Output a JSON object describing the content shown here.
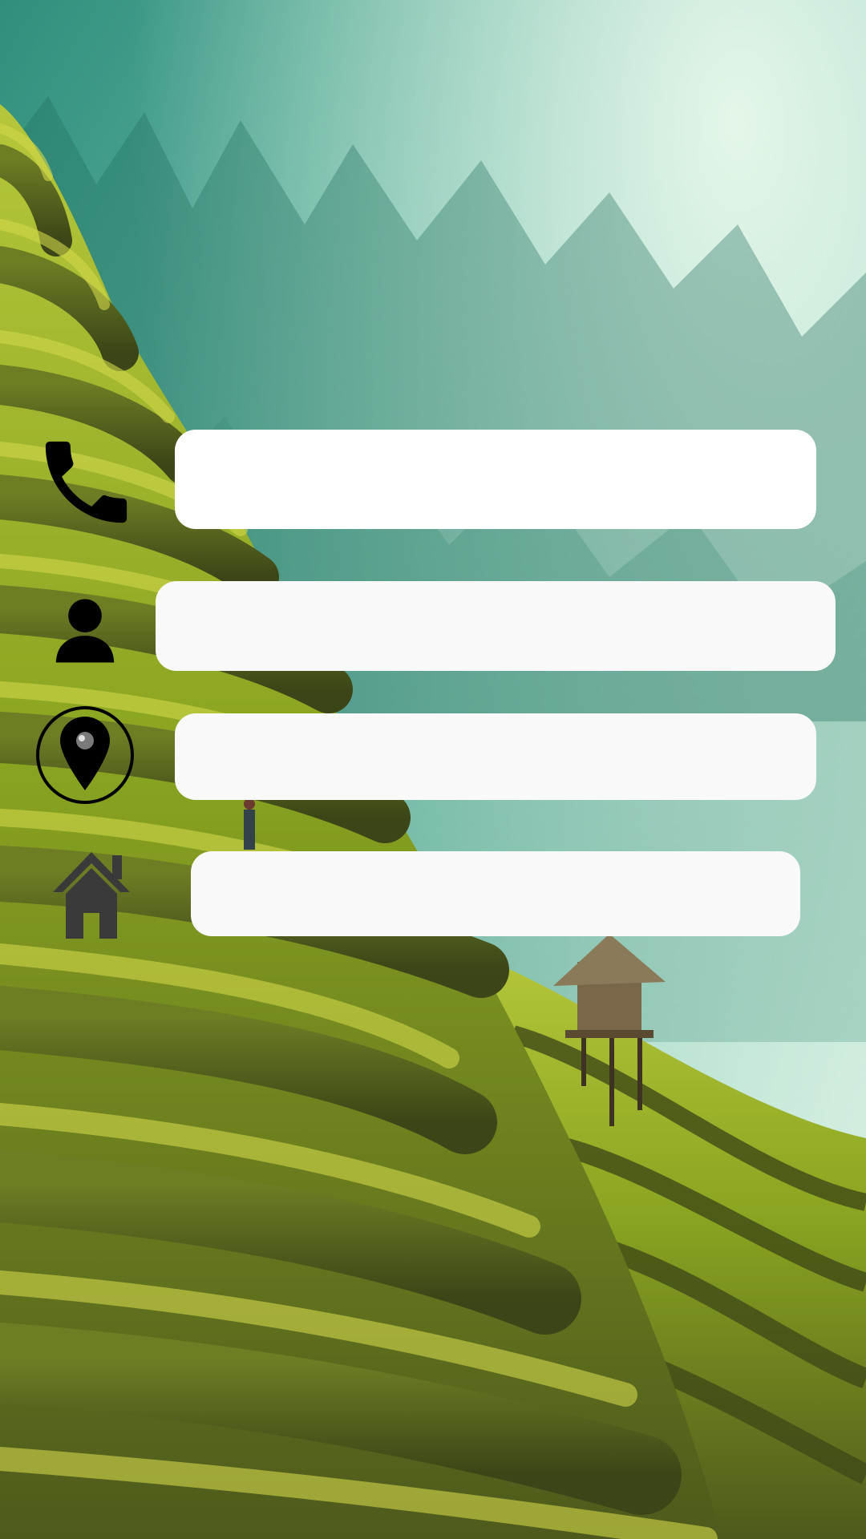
{
  "screen": {
    "background": "terraced-rice-field-photo"
  },
  "form": {
    "fields": [
      {
        "icon": "phone-icon",
        "value": "",
        "placeholder": ""
      },
      {
        "icon": "person-icon",
        "value": "",
        "placeholder": ""
      },
      {
        "icon": "location-pin-icon",
        "value": "",
        "placeholder": ""
      },
      {
        "icon": "home-icon",
        "value": "",
        "placeholder": ""
      }
    ]
  },
  "colors": {
    "field_background": "#f9f9f9",
    "icon_dark": "#000000",
    "home_icon": "#3a3a3a"
  }
}
